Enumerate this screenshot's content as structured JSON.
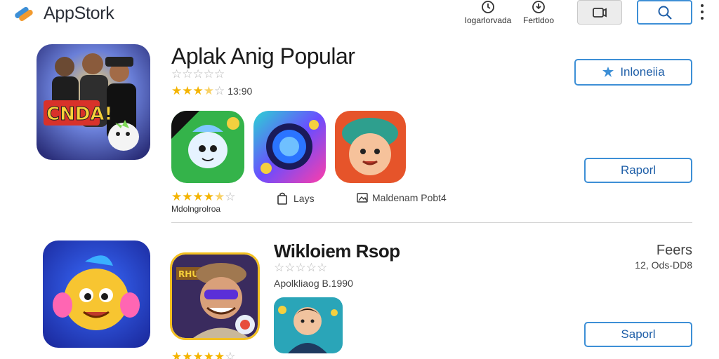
{
  "header": {
    "app_name": "AppStork",
    "nav": [
      {
        "label": "Iogarlorvada",
        "icon": "clock-icon"
      },
      {
        "label": "Fertldoo",
        "icon": "download-icon"
      }
    ],
    "cart_icon": "cart-icon",
    "search_icon": "search-icon",
    "menu_icon": "more-vertical-icon"
  },
  "section1": {
    "title": "Aplak Anig Popular",
    "rating_row1": {
      "stars_on": 0,
      "stars_total": 5
    },
    "rating_row2": {
      "stars_on": 3.5,
      "stars_total": 5,
      "count": "13:90"
    },
    "region_button": "Inloneiia",
    "region_icon": "globe-icon",
    "report_button": "Raporl",
    "sub_rating": {
      "stars_on": 4.5,
      "stars_total": 5,
      "label": "Mdolngrolroa"
    },
    "tags": [
      {
        "label": "Lays",
        "icon": "bag-icon"
      },
      {
        "label": "Maldenam Pobt4",
        "icon": "image-icon"
      }
    ],
    "hero_tile_text": "CNDA!"
  },
  "section2": {
    "title": "Wikloiem Rsop",
    "rating": {
      "stars_on": 0,
      "stars_total": 5
    },
    "meta": "Apolkliaog B.1990",
    "right_label": "Feers",
    "right_sub": "12, Ods-DD8",
    "report_button": "Saporl",
    "bottom_rating": {
      "stars_on": 5,
      "stars_total": 6
    },
    "game_tile_text": "RHUE"
  },
  "colors": {
    "accent": "#3d8fd6",
    "star": "#f4b400",
    "star_off": "#b5b5b5"
  }
}
